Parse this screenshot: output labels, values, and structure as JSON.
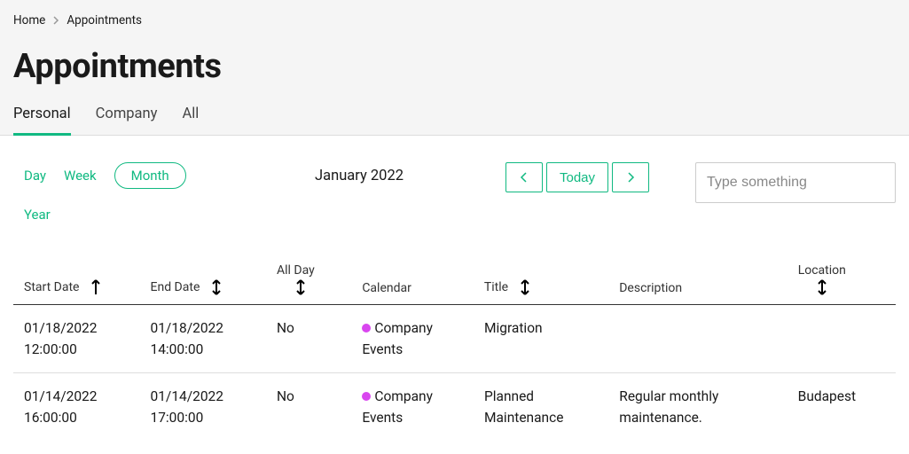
{
  "breadcrumb": {
    "home": "Home",
    "current": "Appointments"
  },
  "page_title": "Appointments",
  "tabs": {
    "personal": "Personal",
    "company": "Company",
    "all": "All",
    "active": "personal"
  },
  "view_toggles": {
    "day": "Day",
    "week": "Week",
    "month": "Month",
    "year": "Year",
    "active": "month"
  },
  "period_label": "January 2022",
  "nav": {
    "today": "Today"
  },
  "search": {
    "placeholder": "Type something",
    "value": ""
  },
  "colors": {
    "accent": "#10b981",
    "calendar_dot": "#d946ef"
  },
  "table": {
    "headers": {
      "start_date": "Start Date",
      "end_date": "End Date",
      "all_day": "All Day",
      "calendar": "Calendar",
      "title": "Title",
      "description": "Description",
      "location": "Location"
    },
    "sort": {
      "column": "start_date",
      "direction": "asc"
    },
    "rows": [
      {
        "start_date": "01/18/2022 12:00:00",
        "end_date": "01/18/2022 14:00:00",
        "all_day": "No",
        "calendar": "Company Events",
        "calendar_color": "#d946ef",
        "title": "Migration",
        "description": "",
        "location": ""
      },
      {
        "start_date": "01/14/2022 16:00:00",
        "end_date": "01/14/2022 17:00:00",
        "all_day": "No",
        "calendar": "Company Events",
        "calendar_color": "#d946ef",
        "title": "Planned Maintenance",
        "description": "Regular monthly maintenance.",
        "location": "Budapest"
      }
    ]
  }
}
